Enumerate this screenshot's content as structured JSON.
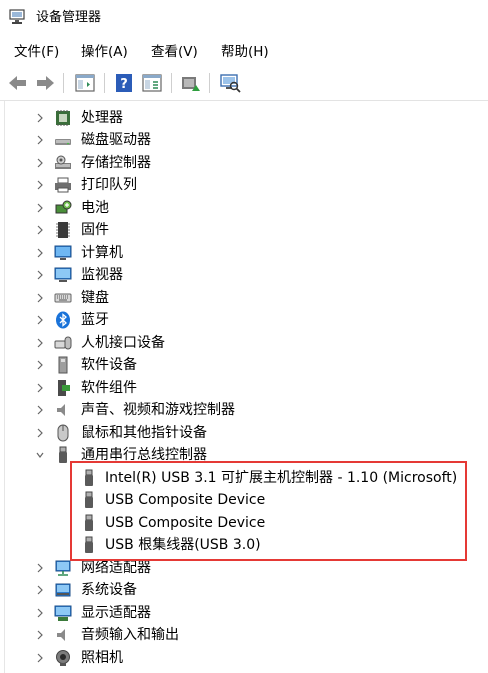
{
  "window": {
    "title": "设备管理器"
  },
  "menu": [
    {
      "label": "文件(F)"
    },
    {
      "label": "操作(A)"
    },
    {
      "label": "查看(V)"
    },
    {
      "label": "帮助(H)"
    }
  ],
  "toolbar": {
    "buttons": [
      "back-icon",
      "forward-icon",
      "show-hide-tree-icon",
      "help-icon",
      "properties-icon",
      "update-driver-icon",
      "scan-hardware-icon"
    ]
  },
  "tree": {
    "categories_before": [
      {
        "label": "处理器",
        "icon": "processor-icon"
      },
      {
        "label": "磁盘驱动器",
        "icon": "disk-drive-icon"
      },
      {
        "label": "存储控制器",
        "icon": "storage-controller-icon"
      },
      {
        "label": "打印队列",
        "icon": "printer-icon"
      },
      {
        "label": "电池",
        "icon": "battery-icon"
      },
      {
        "label": "固件",
        "icon": "firmware-icon"
      },
      {
        "label": "计算机",
        "icon": "computer-icon"
      },
      {
        "label": "监视器",
        "icon": "monitor-icon"
      },
      {
        "label": "键盘",
        "icon": "keyboard-icon"
      },
      {
        "label": "蓝牙",
        "icon": "bluetooth-icon"
      },
      {
        "label": "人机接口设备",
        "icon": "hid-icon"
      },
      {
        "label": "软件设备",
        "icon": "software-device-icon"
      },
      {
        "label": "软件组件",
        "icon": "software-component-icon"
      },
      {
        "label": "声音、视频和游戏控制器",
        "icon": "sound-icon"
      },
      {
        "label": "鼠标和其他指针设备",
        "icon": "mouse-icon"
      }
    ],
    "expanded": {
      "label": "通用串行总线控制器",
      "icon": "usb-icon",
      "children": [
        {
          "label": "Intel(R) USB 3.1 可扩展主机控制器 - 1.10 (Microsoft)"
        },
        {
          "label": "USB Composite Device"
        },
        {
          "label": "USB Composite Device"
        },
        {
          "label": "USB 根集线器(USB 3.0)"
        }
      ]
    },
    "categories_after": [
      {
        "label": "网络适配器",
        "icon": "network-adapter-icon"
      },
      {
        "label": "系统设备",
        "icon": "system-device-icon"
      },
      {
        "label": "显示适配器",
        "icon": "display-adapter-icon"
      },
      {
        "label": "音频输入和输出",
        "icon": "audio-io-icon"
      },
      {
        "label": "照相机",
        "icon": "camera-icon"
      }
    ]
  },
  "colors": {
    "highlight_border": "#e53935"
  }
}
